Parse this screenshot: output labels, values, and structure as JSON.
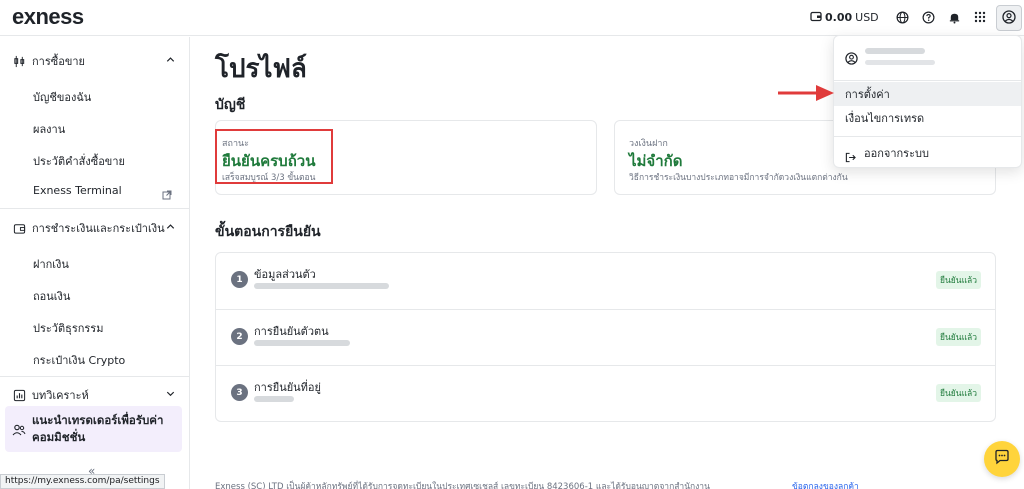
{
  "header": {
    "logo": "exness",
    "balance": "0.00",
    "currency": "USD"
  },
  "sidebar": {
    "trading": {
      "title": "การซื้อขาย",
      "items": [
        "บัญชีของฉัน",
        "ผลงาน",
        "ประวัติคำสั่งซื้อขาย",
        "Exness Terminal"
      ]
    },
    "payments": {
      "title": "การชำระเงินและกระเป๋าเงิน",
      "items": [
        "ฝากเงิน",
        "ถอนเงิน",
        "ประวัติธุรกรรม",
        "กระเป๋าเงิน Crypto"
      ]
    },
    "analytics": {
      "title": "บทวิเคราะห์"
    },
    "promo": "แนะนำเทรดเดอร์เพื่อรับค่าคอมมิชชั่น",
    "collapse": "«"
  },
  "status_url": "https://my.exness.com/pa/settings",
  "main": {
    "title": "โปรไฟล์",
    "account_heading": "บัญชี",
    "status_card": {
      "label": "สถานะ",
      "value": "ยืนยันครบถ้วน",
      "sub": "เสร็จสมบูรณ์ 3/3 ขั้นตอน"
    },
    "deposit_card": {
      "label": "วงเงินฝาก",
      "value": "ไม่จำกัด",
      "sub": "วิธีการชำระเงินบางประเภทอาจมีการจำกัดวงเงินแตกต่างกัน"
    },
    "steps_heading": "ขั้นตอนการยืนยัน",
    "steps": [
      {
        "num": "1",
        "title": "ข้อมูลส่วนตัว",
        "badge": "ยืนยันแล้ว"
      },
      {
        "num": "2",
        "title": "การยืนยันตัวตน",
        "badge": "ยืนยันแล้ว"
      },
      {
        "num": "3",
        "title": "การยืนยันที่อยู่",
        "badge": "ยืนยันแล้ว"
      }
    ],
    "footer": "Exness (SC) LTD เป็นผู้ค้าหลักทรัพย์ที่ได้รับการจดทะเบียนในประเทศเซเชลส์ เลขทะเบียน 8423606-1 และได้รับอนุญาตจากสำนักงาน",
    "footer_link": "ข้อตกลงของลูกค้า"
  },
  "dropdown": {
    "items": [
      "การตั้งค่า",
      "เงื่อนไขการเทรด",
      "ออกจากระบบ"
    ]
  },
  "colors": {
    "verified_green": "#1f7a3b",
    "highlight_red": "#e03b3b",
    "chat_yellow": "#ffd43b"
  }
}
